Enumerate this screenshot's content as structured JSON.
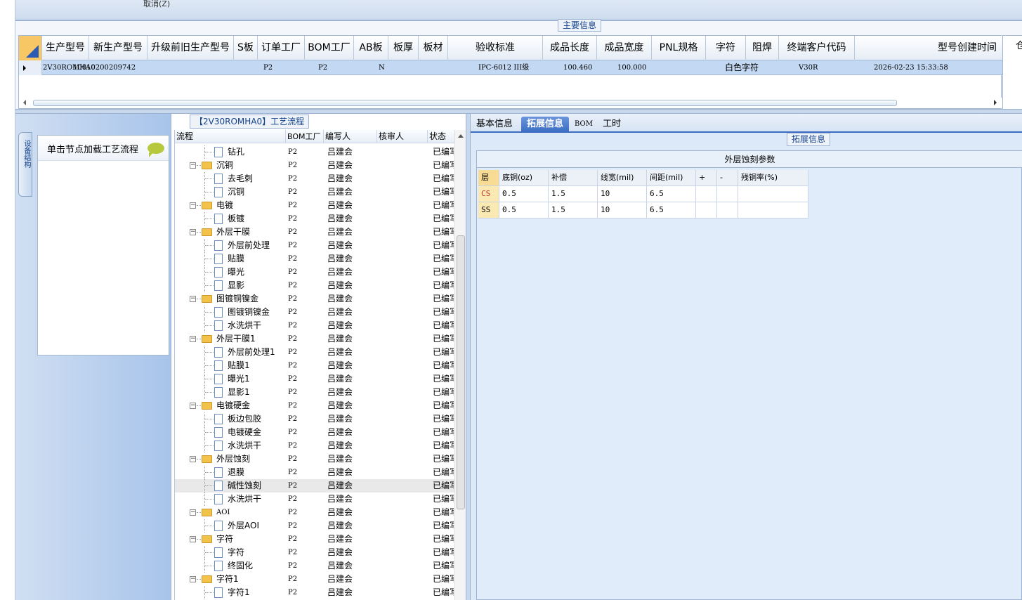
{
  "top": {
    "cancel_label": "取消(Z)"
  },
  "main": {
    "title": "主要信息",
    "columns": [
      "生产型号",
      "新生产型号",
      "升级前旧生产型号",
      "S板",
      "订单工厂",
      "BOM工厂",
      "AB板",
      "板厚",
      "板材",
      "验收标准",
      "成品长度",
      "成品宽度",
      "PNL规格",
      "字符",
      "阻焊",
      "终端客户代码",
      "型号创建时间"
    ],
    "extra_column_fragment": "仓",
    "row": [
      "2V30ROMHA0",
      "10010200209742",
      "",
      "",
      "P2",
      "P2",
      "N",
      "",
      "",
      "IPC-6012 III级",
      "100.460",
      "100.000",
      "",
      "白色字符",
      "",
      "V30R",
      "2026-02-23 15:33:58"
    ]
  },
  "flow": {
    "title": "【2V30ROMHA0】工艺流程",
    "vertical_tab": "设备结构",
    "load_hint": "单击节点加载工艺流程",
    "headers": {
      "process": "流程",
      "bom": "BOM工厂",
      "writer": "编写人",
      "reviewer": "核审人",
      "status": "状态"
    },
    "rows": [
      {
        "name": "钻孔",
        "level": 1,
        "bom": "P2",
        "writer": "吕建会",
        "status": "已编写"
      },
      {
        "name": "沉铜",
        "level": 0,
        "bom": "P2",
        "writer": "吕建会",
        "status": "已编写"
      },
      {
        "name": "去毛刺",
        "level": 1,
        "bom": "P2",
        "writer": "吕建会",
        "status": "已编写"
      },
      {
        "name": "沉铜",
        "level": 1,
        "bom": "P2",
        "writer": "吕建会",
        "status": "已编写"
      },
      {
        "name": "电镀",
        "level": 0,
        "bom": "P2",
        "writer": "吕建会",
        "status": "已编写"
      },
      {
        "name": "板镀",
        "level": 1,
        "bom": "P2",
        "writer": "吕建会",
        "status": "已编写"
      },
      {
        "name": "外层干膜",
        "level": 0,
        "bom": "P2",
        "writer": "吕建会",
        "status": "已编写"
      },
      {
        "name": "外层前处理",
        "level": 1,
        "bom": "P2",
        "writer": "吕建会",
        "status": "已编写"
      },
      {
        "name": "贴膜",
        "level": 1,
        "bom": "P2",
        "writer": "吕建会",
        "status": "已编写"
      },
      {
        "name": "曝光",
        "level": 1,
        "bom": "P2",
        "writer": "吕建会",
        "status": "已编写"
      },
      {
        "name": "显影",
        "level": 1,
        "bom": "P2",
        "writer": "吕建会",
        "status": "已编写"
      },
      {
        "name": "图镀铜镍金",
        "level": 0,
        "bom": "P2",
        "writer": "吕建会",
        "status": "已编写"
      },
      {
        "name": "图镀铜镍金",
        "level": 1,
        "bom": "P2",
        "writer": "吕建会",
        "status": "已编写"
      },
      {
        "name": "水洗烘干",
        "level": 1,
        "bom": "P2",
        "writer": "吕建会",
        "status": "已编写"
      },
      {
        "name": "外层干膜1",
        "level": 0,
        "bom": "P2",
        "writer": "吕建会",
        "status": "已编写"
      },
      {
        "name": "外层前处理1",
        "level": 1,
        "bom": "P2",
        "writer": "吕建会",
        "status": "已编写"
      },
      {
        "name": "贴膜1",
        "level": 1,
        "bom": "P2",
        "writer": "吕建会",
        "status": "已编写"
      },
      {
        "name": "曝光1",
        "level": 1,
        "bom": "P2",
        "writer": "吕建会",
        "status": "已编写"
      },
      {
        "name": "显影1",
        "level": 1,
        "bom": "P2",
        "writer": "吕建会",
        "status": "已编写"
      },
      {
        "name": "电镀硬金",
        "level": 0,
        "bom": "P2",
        "writer": "吕建会",
        "status": "已编写"
      },
      {
        "name": "板边包胶",
        "level": 1,
        "bom": "P2",
        "writer": "吕建会",
        "status": "已编写"
      },
      {
        "name": "电镀硬金",
        "level": 1,
        "bom": "P2",
        "writer": "吕建会",
        "status": "已编写"
      },
      {
        "name": "水洗烘干",
        "level": 1,
        "bom": "P2",
        "writer": "吕建会",
        "status": "已编写"
      },
      {
        "name": "外层蚀刻",
        "level": 0,
        "bom": "P2",
        "writer": "吕建会",
        "status": "已编写"
      },
      {
        "name": "退膜",
        "level": 1,
        "bom": "P2",
        "writer": "吕建会",
        "status": "已编写"
      },
      {
        "name": "碱性蚀刻",
        "level": 1,
        "bom": "P2",
        "writer": "吕建会",
        "status": "已编写",
        "selected": true
      },
      {
        "name": "水洗烘干",
        "level": 1,
        "bom": "P2",
        "writer": "吕建会",
        "status": "已编写"
      },
      {
        "name": "AOI",
        "level": 0,
        "bom": "P2",
        "writer": "吕建会",
        "status": "已编写"
      },
      {
        "name": "外层AOI",
        "level": 1,
        "bom": "P2",
        "writer": "吕建会",
        "status": "已编写"
      },
      {
        "name": "字符",
        "level": 0,
        "bom": "P2",
        "writer": "吕建会",
        "status": "已编写"
      },
      {
        "name": "字符",
        "level": 1,
        "bom": "P2",
        "writer": "吕建会",
        "status": "已编写"
      },
      {
        "name": "终固化",
        "level": 1,
        "bom": "P2",
        "writer": "吕建会",
        "status": "已编写"
      },
      {
        "name": "字符1",
        "level": 0,
        "bom": "P2",
        "writer": "吕建会",
        "status": "已编写"
      },
      {
        "name": "字符1",
        "level": 1,
        "bom": "P2",
        "writer": "吕建会",
        "status": "已编写"
      }
    ]
  },
  "right": {
    "tabs": [
      "基本信息",
      "拓展信息",
      "BOM",
      "工时"
    ],
    "active_tab": 1,
    "ext_title": "拓展信息",
    "section_title": "外层蚀刻参数",
    "param_headers": [
      "层",
      "底铜(oz)",
      "补偿",
      "线宽(mil)",
      "间距(mil)",
      "+",
      "-",
      "残铜率(%)"
    ],
    "param_rows": [
      [
        "CS",
        "0.5",
        "1.5",
        "10",
        "6.5",
        "",
        "",
        ""
      ],
      [
        "SS",
        "0.5",
        "1.5",
        "10",
        "6.5",
        "",
        "",
        ""
      ]
    ]
  }
}
